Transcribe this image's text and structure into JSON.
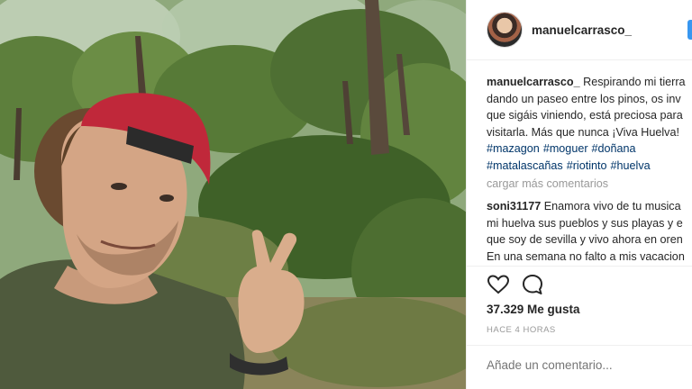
{
  "post": {
    "username": "manuelcarrasco_",
    "caption_lines": [
      "Respirando mi tierra",
      "dando un paseo entre los pinos, os inv",
      "que sigáis viniendo, está preciosa para",
      "visitarla. Más que nunca ¡Viva Huelva!"
    ],
    "hashtags_line1": [
      "#mazagon",
      "#moguer",
      "#doñana"
    ],
    "hashtags_line2": [
      "#matalascañas",
      "#riotinto",
      "#huelva"
    ],
    "load_more": "cargar más comentarios",
    "comment": {
      "username": "soni31177",
      "lines": [
        "Enamora vivo de tu musica",
        "mi huelva sus pueblos y sus playas y e",
        "que soy de sevilla y vivo ahora en oren",
        "En una semana no falto a mis vacacion"
      ]
    },
    "likes": "37.329 Me gusta",
    "time_ago": "HACE 4 HORAS",
    "add_comment_placeholder": "Añade un comentario..."
  },
  "icons": {
    "like": "heart-icon",
    "comment": "comment-icon"
  },
  "colors": {
    "hashtag": "#003569",
    "muted": "#999999",
    "follow": "#3897f0",
    "cap": "#c0283a"
  }
}
